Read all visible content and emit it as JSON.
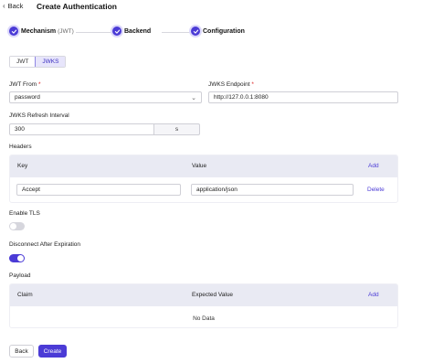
{
  "header": {
    "back_label": "Back",
    "title": "Create Authentication"
  },
  "steps": [
    {
      "label": "Mechanism",
      "sub": "(JWT)"
    },
    {
      "label": "Backend",
      "sub": ""
    },
    {
      "label": "Configuration",
      "sub": ""
    }
  ],
  "type_tabs": [
    {
      "label": "JWT",
      "selected": false
    },
    {
      "label": "JWKS",
      "selected": true
    }
  ],
  "form": {
    "jwt_from": {
      "label": "JWT From",
      "required_mark": "*",
      "value": "password"
    },
    "jwks_endpoint": {
      "label": "JWKS Endpoint",
      "required_mark": "*",
      "value": "http://127.0.0.1:8080"
    },
    "refresh_interval": {
      "label": "JWKS Refresh Interval",
      "value": "300",
      "unit": "s"
    }
  },
  "headers_section": {
    "title": "Headers",
    "columns": {
      "key": "Key",
      "value": "Value",
      "add": "Add"
    },
    "rows": [
      {
        "key": "Accept",
        "value": "application/json",
        "action": "Delete"
      }
    ]
  },
  "enable_tls": {
    "label": "Enable TLS",
    "on": false
  },
  "disconnect_after_expiration": {
    "label": "Disconnect After Expiration",
    "on": true
  },
  "payload_section": {
    "title": "Payload",
    "columns": {
      "claim": "Claim",
      "expected": "Expected Value",
      "add": "Add"
    },
    "empty_text": "No Data"
  },
  "footer": {
    "back_label": "Back",
    "create_label": "Create"
  },
  "colors": {
    "accent": "#4b3bd6",
    "table_header": "#e9eaf3"
  }
}
